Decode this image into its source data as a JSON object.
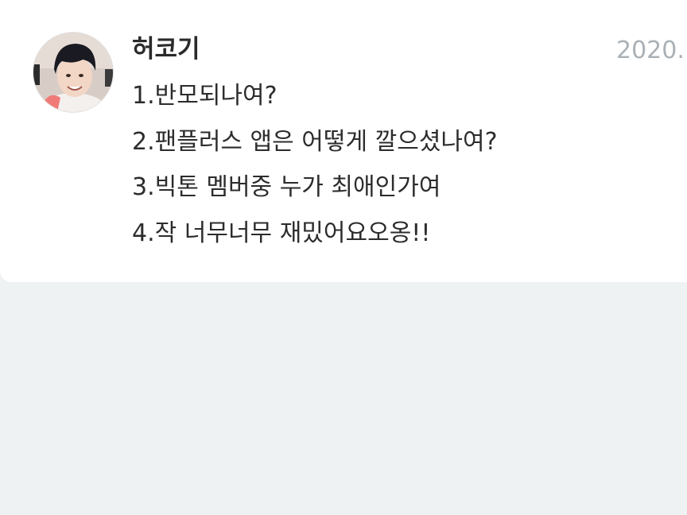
{
  "comment": {
    "author": "허코기",
    "timestamp": "2020.",
    "lines": [
      "1.반모되나여?",
      "2.팬플러스 앱은 어떻게 깔으셨나여?",
      "3.빅톤 멤버중 누가 최애인가여",
      "4.작 너무너무 재밌어요오옹!!"
    ]
  },
  "colors": {
    "card_background": "#ffffff",
    "page_background": "#eff2f2",
    "author_text": "#2a2a2a",
    "timestamp_text": "#aab1b6",
    "body_text": "#2c2c2c"
  }
}
